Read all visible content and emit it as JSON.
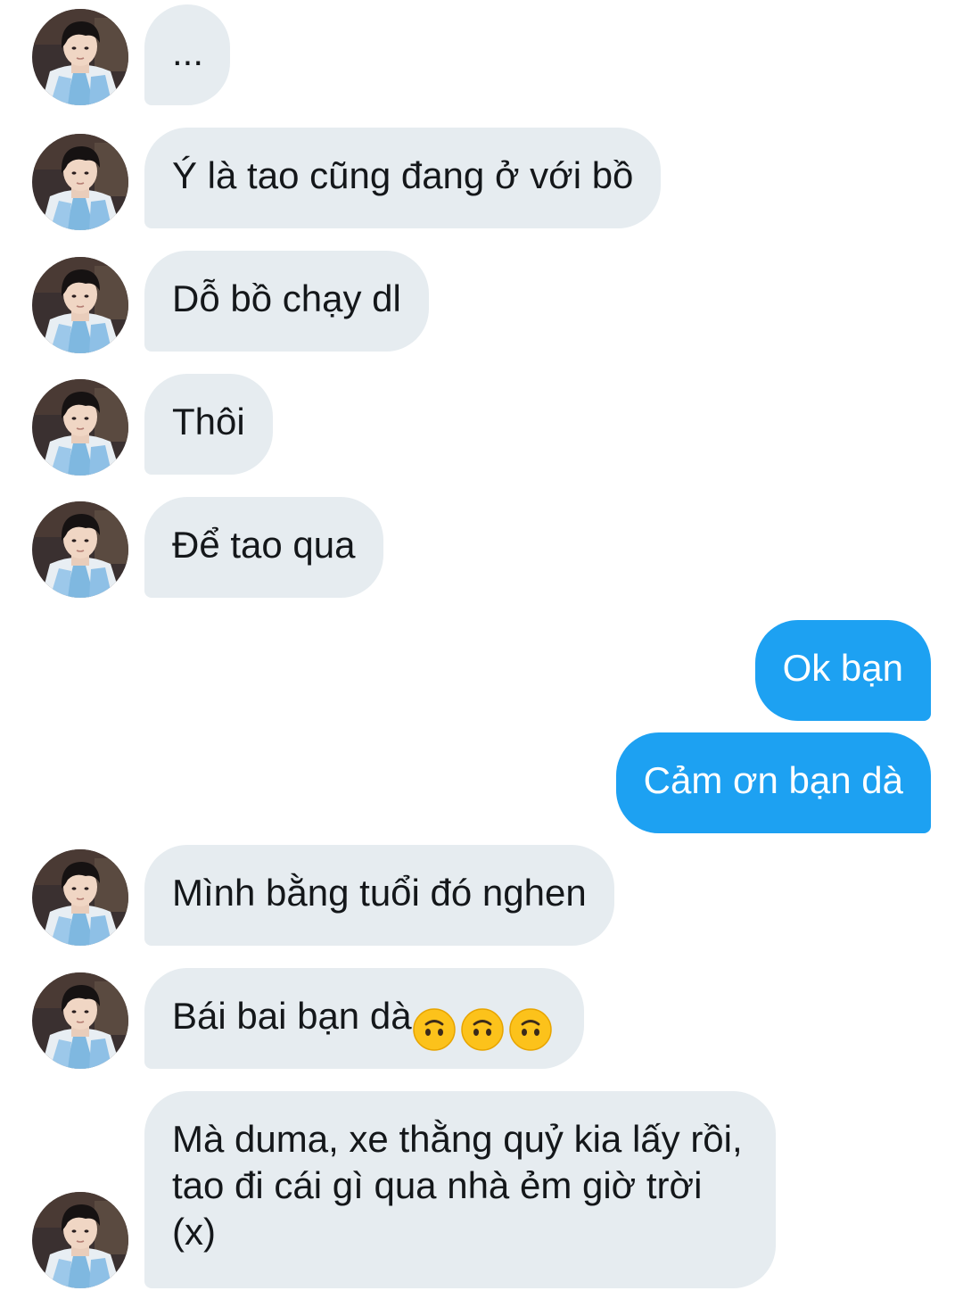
{
  "conversation": {
    "messages": [
      {
        "side": "in",
        "text": "...",
        "avatar": "contact-avatar"
      },
      {
        "side": "in",
        "text": "Ý là tao cũng đang ở với bồ",
        "avatar": "contact-avatar"
      },
      {
        "side": "in",
        "text": "Dỗ bồ chạy dl",
        "avatar": "contact-avatar"
      },
      {
        "side": "in",
        "text": "Thôi",
        "avatar": "contact-avatar"
      },
      {
        "side": "in",
        "text": "Để tao qua",
        "avatar": "contact-avatar"
      },
      {
        "side": "out",
        "text": "Ok bạn"
      },
      {
        "side": "out",
        "text": "Cảm ơn bạn dà"
      },
      {
        "side": "in",
        "text": "Mình bằng tuổi đó nghen",
        "avatar": "contact-avatar"
      },
      {
        "side": "in",
        "text": "Bái bai bạn dà",
        "emoji": [
          "upside-down-face-emoji",
          "upside-down-face-emoji",
          "upside-down-face-emoji"
        ],
        "avatar": "contact-avatar"
      },
      {
        "side": "in",
        "text": "Mà duma, xe thằng quỷ kia lấy rồi, tao đi cái gì qua nhà ẻm giờ trời (x)",
        "avatar": "contact-avatar"
      }
    ]
  },
  "colors": {
    "incoming_bubble": "#e6ecf0",
    "outgoing_bubble": "#1da1f2",
    "incoming_text": "#14171a",
    "outgoing_text": "#ffffff",
    "background": "#ffffff"
  }
}
